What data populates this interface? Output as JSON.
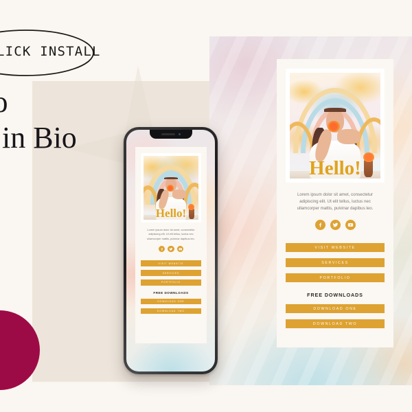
{
  "badge": {
    "label": "LICK INSTALL",
    "shape": "ellipse-outline"
  },
  "headline": {
    "line1": "co",
    "line2": "k in Bio"
  },
  "colors": {
    "page_background": "#faf6f1",
    "beige_block": "#ede5db",
    "accent_button": "#dda232",
    "accent_hello": "#e0a31f",
    "magenta_circle": "#9d0b46",
    "card_background": "#fbf7f2",
    "body_text": "#7e7873",
    "heading_text": "#2b2723"
  },
  "bio_card": {
    "photo": {
      "alt_name": "woman-holding-flower-photo",
      "overlay_text": "Hello!"
    },
    "bio_text": "Lorem ipsum dolor sit amet, consectetur adipiscing elit. Ut elit tellus, luctus nec ullamcorper mattis, pulvinar dapibus leo.",
    "socials": [
      {
        "name": "facebook-icon",
        "glyph": "f"
      },
      {
        "name": "twitter-icon",
        "glyph": "t"
      },
      {
        "name": "youtube-icon",
        "glyph": "y"
      }
    ],
    "links": [
      {
        "label": "VISIT WEBSITE"
      },
      {
        "label": "SERVICES"
      },
      {
        "label": "PORTFOLIO"
      }
    ],
    "downloads_heading": "FREE DOWNLOADS",
    "downloads": [
      {
        "label": "DOWNLOAD ONE"
      },
      {
        "label": "DOWNLOAD TWO"
      }
    ]
  },
  "mockups": {
    "phone_name": "smartphone-mockup",
    "panel_name": "watercolor-backdrop-panel"
  }
}
